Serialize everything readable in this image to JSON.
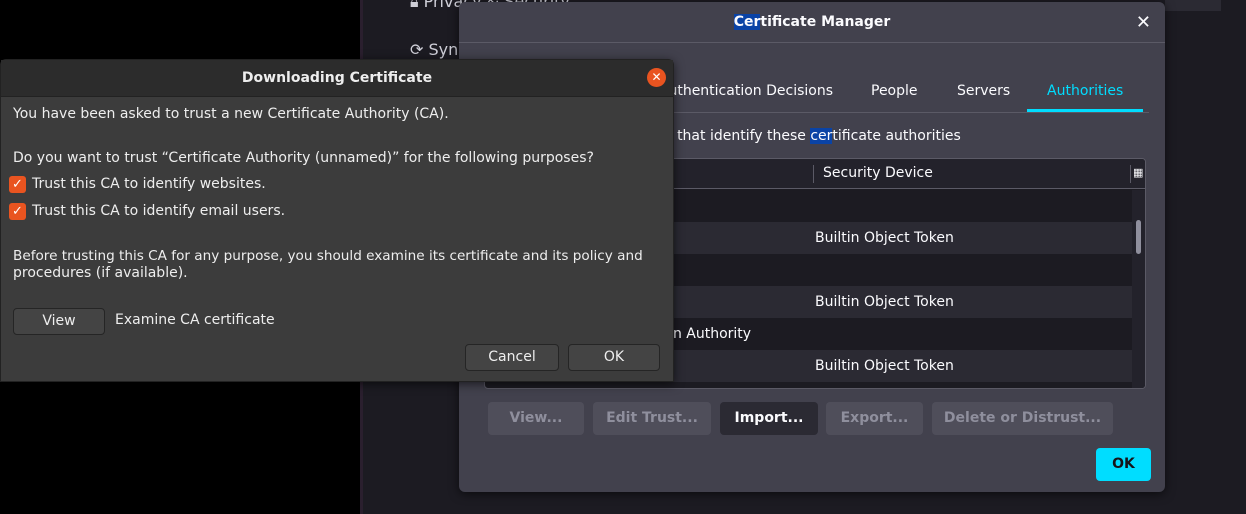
{
  "background": {
    "sidebar_items": [
      "Privacy & Security",
      "Sync"
    ]
  },
  "cert_manager": {
    "title_highlight": "Cer",
    "title_rest": "tificate Manager",
    "tabs": [
      {
        "label": "Authentication Decisions",
        "visible_label": "uthentication Decisions",
        "active": false
      },
      {
        "label": "People",
        "active": false
      },
      {
        "label": "Servers",
        "active": false
      },
      {
        "label": "Authorities",
        "active": true
      }
    ],
    "description_pre": "e that identify these ",
    "description_highlight": "cer",
    "description_post": "tificate authorities",
    "table": {
      "columns": [
        "",
        "Security Device"
      ],
      "rows": [
        {
          "name": "",
          "device": ""
        },
        {
          "name": "",
          "device": "Builtin Object Token"
        },
        {
          "name": "",
          "device": ""
        },
        {
          "name": "",
          "device": "Builtin Object Token"
        },
        {
          "name": "tion Authority",
          "device": ""
        },
        {
          "name": "",
          "device": "Builtin Object Token"
        }
      ]
    },
    "buttons": {
      "view": "View...",
      "edit_trust": "Edit Trust...",
      "import": "Import...",
      "export": "Export...",
      "delete": "Delete or Distrust..."
    },
    "ok": "OK",
    "accent": "#00ddff"
  },
  "download_dialog": {
    "title": "Downloading Certificate",
    "intro": "You have been asked to trust a new Certificate Authority (CA).",
    "question": "Do you want to trust “Certificate Authority (unnamed)” for the following purposes?",
    "options": [
      {
        "label": "Trust this CA to identify websites.",
        "checked": true
      },
      {
        "label": "Trust this CA to identify email users.",
        "checked": true
      }
    ],
    "warning_line1": "Before trusting this CA for any purpose, you should examine its certificate and its policy and",
    "warning_line2": "procedures (if available).",
    "view_button": "View",
    "view_caption": "Examine CA certificate",
    "cancel": "Cancel",
    "ok": "OK",
    "accent": "#e95420"
  }
}
